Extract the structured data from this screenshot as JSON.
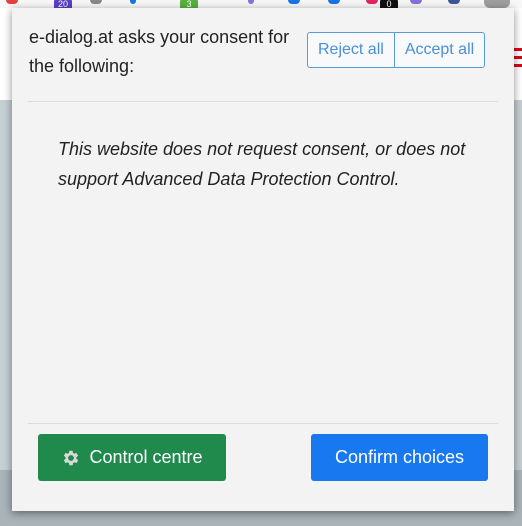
{
  "browser": {
    "extension_badges": [
      "20",
      "3",
      "0"
    ]
  },
  "consent_popup": {
    "header_text": "e-dialog.at asks your consent for the following:",
    "reject_all_label": "Reject all",
    "accept_all_label": "Accept all",
    "message": "This website does not request consent, or does not support Advanced Data Protection Control.",
    "control_centre_label": "Control centre",
    "control_centre_icon": "gear-icon",
    "confirm_label": "Confirm choices"
  },
  "colors": {
    "control_centre_button": "#1f8a4c",
    "confirm_button": "#1878f0",
    "outline_button": "#4a8fd8",
    "popup_background": "#f3f3f3"
  }
}
